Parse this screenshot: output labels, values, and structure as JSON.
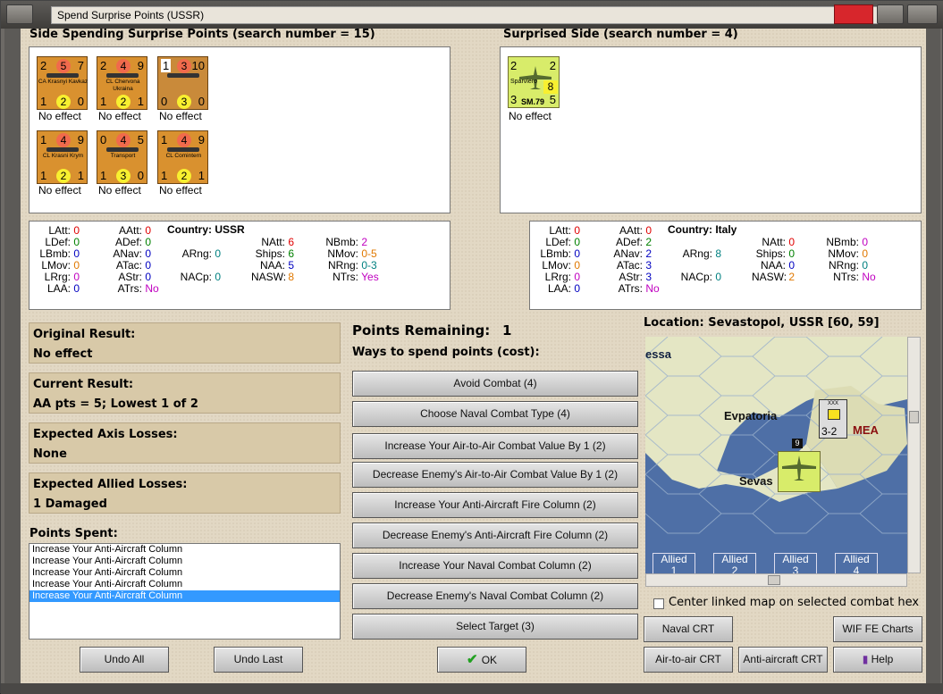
{
  "window": {
    "title": "Spend Surprise Points (USSR)"
  },
  "left_header": "Side Spending Surprise Points (search number = 15)",
  "right_header": "Surprised Side (search number = 4)",
  "spending_units": [
    {
      "top_left": "2",
      "top_mid": "5",
      "top_right": "7",
      "name": "CA Krasnyi Kavkaz",
      "bl": "1",
      "bm": "2",
      "br": "0",
      "effect": "No effect"
    },
    {
      "top_left": "2",
      "top_mid": "4",
      "top_right": "9",
      "name": "CL Chervona Ukraina",
      "bl": "1",
      "bm": "2",
      "br": "1",
      "effect": "No effect"
    },
    {
      "top_left": "1",
      "top_mid": "3",
      "top_right": "10",
      "name": "",
      "bl": "0",
      "bm": "3",
      "br": "0",
      "effect": "No effect"
    },
    {
      "top_left": "1",
      "top_mid": "4",
      "top_right": "9",
      "name": "CL Krasni Krym",
      "bl": "1",
      "bm": "2",
      "br": "1",
      "effect": "No effect"
    },
    {
      "top_left": "0",
      "top_mid": "4",
      "top_right": "5",
      "name": "Transport",
      "bl": "1",
      "bm": "3",
      "br": "0",
      "effect": "No effect"
    },
    {
      "top_left": "1",
      "top_mid": "4",
      "top_right": "9",
      "name": "CL Comintern",
      "bl": "1",
      "bm": "2",
      "br": "1",
      "effect": "No effect"
    }
  ],
  "surprised_unit": {
    "tl": "2",
    "tr": "2",
    "name": "Sparviero",
    "mid": "8",
    "bl": "3",
    "type": "SM.79",
    "br": "5",
    "effect": "No effect"
  },
  "left_stats": {
    "country_label": "Country:",
    "country": "USSR",
    "LAtt": "0",
    "LDef": "0",
    "LBmb": "0",
    "LMov": "0",
    "LRrg": "0",
    "LAA": "0",
    "AAtt": "0",
    "ADef": "0",
    "ANav": "0",
    "ATac": "0",
    "AStr": "0",
    "ATrs": "No",
    "ARng": "0",
    "NACp": "0",
    "NAtt": "6",
    "Ships": "6",
    "NAA": "5",
    "NASW": "8",
    "NBmb": "2",
    "NMov": "0-5",
    "NRng": "0-3",
    "NTrs": "Yes"
  },
  "right_stats": {
    "country_label": "Country:",
    "country": "Italy",
    "LAtt": "0",
    "LDef": "0",
    "LBmb": "0",
    "LMov": "0",
    "LRrg": "0",
    "LAA": "0",
    "AAtt": "0",
    "ADef": "2",
    "ANav": "2",
    "ATac": "3",
    "AStr": "3",
    "ATrs": "No",
    "ARng": "8",
    "NACp": "0",
    "NAtt": "0",
    "Ships": "0",
    "NAA": "0",
    "NASW": "2",
    "NBmb": "0",
    "NMov": "0",
    "NRng": "0",
    "NTrs": "No"
  },
  "results": {
    "original_label": "Original Result:",
    "original": "No effect",
    "current_label": "Current Result:",
    "current": "AA pts = 5; Lowest 1 of 2",
    "axis_label": "Expected Axis Losses:",
    "axis": "None",
    "allied_label": "Expected Allied Losses:",
    "allied": "1 Damaged"
  },
  "points_spent_label": "Points Spent:",
  "points_spent": [
    "Increase Your Anti-Aircraft Column",
    "Increase Your Anti-Aircraft Column",
    "Increase Your Anti-Aircraft Column",
    "Increase Your Anti-Aircraft Column",
    "Increase Your Anti-Aircraft Column"
  ],
  "points_remaining_label": "Points Remaining:",
  "points_remaining": "1",
  "ways_label": "Ways to spend points (cost):",
  "options": [
    "Avoid Combat (4)",
    "Choose Naval Combat Type (4)",
    "Increase Your Air-to-Air Combat Value By 1 (2)",
    "Decrease Enemy's Air-to-Air Combat Value By 1 (2)",
    "Increase Your Anti-Aircraft Fire Column (2)",
    "Decrease Enemy's Anti-Aircraft Fire Column (2)",
    "Increase Your Naval Combat Column (2)",
    "Decrease Enemy's Naval Combat Column (2)",
    "Select Target (3)"
  ],
  "location": "Location: Sevastopol, USSR [60, 59]",
  "map": {
    "labels": {
      "essa": "essa",
      "evpatoria": "Evpatoria",
      "mea": "MEA",
      "sevas": "Sevas"
    },
    "tabs": [
      "Allied",
      "Allied",
      "Allied",
      "Allied"
    ],
    "tab_nums": [
      "1",
      "2",
      "3",
      "4"
    ],
    "unit": {
      "top": "XXX",
      "val": "3-2",
      "stack": "9"
    }
  },
  "center_linked_label": "Center linked map on selected combat hex",
  "buttons": {
    "undo_all": "Undo All",
    "undo_last": "Undo Last",
    "ok": "OK",
    "naval_crt": "Naval CRT",
    "wif_fe": "WIF FE Charts",
    "air_crt": "Air-to-air CRT",
    "aa_crt": "Anti-aircraft CRT",
    "help": "Help"
  },
  "colors": {
    "red": "#e00000",
    "green": "#008000",
    "blue": "#0000c0",
    "purple": "#c000c0",
    "orange": "#e07800",
    "teal": "#008080"
  }
}
